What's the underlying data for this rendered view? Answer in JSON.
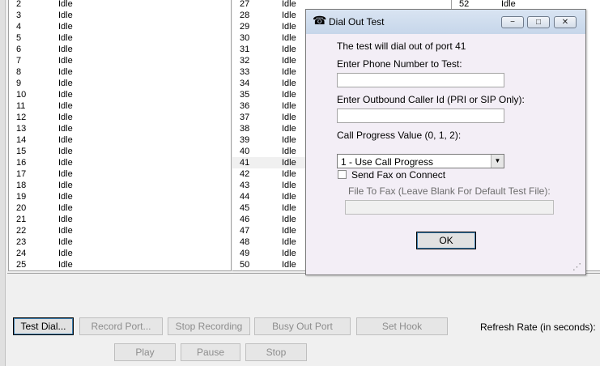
{
  "ports": {
    "column1": [
      {
        "port": "2",
        "status": "Idle"
      },
      {
        "port": "3",
        "status": "Idle"
      },
      {
        "port": "4",
        "status": "Idle"
      },
      {
        "port": "5",
        "status": "Idle"
      },
      {
        "port": "6",
        "status": "Idle"
      },
      {
        "port": "7",
        "status": "Idle"
      },
      {
        "port": "8",
        "status": "Idle"
      },
      {
        "port": "9",
        "status": "Idle"
      },
      {
        "port": "10",
        "status": "Idle"
      },
      {
        "port": "11",
        "status": "Idle"
      },
      {
        "port": "12",
        "status": "Idle"
      },
      {
        "port": "13",
        "status": "Idle"
      },
      {
        "port": "14",
        "status": "Idle"
      },
      {
        "port": "15",
        "status": "Idle"
      },
      {
        "port": "16",
        "status": "Idle"
      },
      {
        "port": "17",
        "status": "Idle"
      },
      {
        "port": "18",
        "status": "Idle"
      },
      {
        "port": "19",
        "status": "Idle"
      },
      {
        "port": "20",
        "status": "Idle"
      },
      {
        "port": "21",
        "status": "Idle"
      },
      {
        "port": "22",
        "status": "Idle"
      },
      {
        "port": "23",
        "status": "Idle"
      },
      {
        "port": "24",
        "status": "Idle"
      },
      {
        "port": "25",
        "status": "Idle"
      }
    ],
    "column2": [
      {
        "port": "27",
        "status": "Idle"
      },
      {
        "port": "28",
        "status": "Idle"
      },
      {
        "port": "29",
        "status": "Idle"
      },
      {
        "port": "30",
        "status": "Idle"
      },
      {
        "port": "31",
        "status": "Idle"
      },
      {
        "port": "32",
        "status": "Idle"
      },
      {
        "port": "33",
        "status": "Idle"
      },
      {
        "port": "34",
        "status": "Idle"
      },
      {
        "port": "35",
        "status": "Idle"
      },
      {
        "port": "36",
        "status": "Idle"
      },
      {
        "port": "37",
        "status": "Idle"
      },
      {
        "port": "38",
        "status": "Idle"
      },
      {
        "port": "39",
        "status": "Idle"
      },
      {
        "port": "40",
        "status": "Idle"
      },
      {
        "port": "41",
        "status": "Idle",
        "highlighted": true
      },
      {
        "port": "42",
        "status": "Idle"
      },
      {
        "port": "43",
        "status": "Idle"
      },
      {
        "port": "44",
        "status": "Idle"
      },
      {
        "port": "45",
        "status": "Idle"
      },
      {
        "port": "46",
        "status": "Idle"
      },
      {
        "port": "47",
        "status": "Idle"
      },
      {
        "port": "48",
        "status": "Idle"
      },
      {
        "port": "49",
        "status": "Idle"
      },
      {
        "port": "50",
        "status": "Idle"
      }
    ],
    "column3": [
      {
        "port": "52",
        "status": "Idle"
      }
    ]
  },
  "buttons": {
    "test_dial": "Test Dial...",
    "record_port": "Record Port...",
    "stop_recording": "Stop Recording",
    "busy_out_port": "Busy Out Port",
    "set_hook": "Set Hook",
    "play": "Play",
    "pause": "Pause",
    "stop": "Stop"
  },
  "refresh_rate_label": "Refresh Rate (in seconds):",
  "dialog": {
    "title": "Dial Out Test",
    "title_icon": "phone-icon",
    "intro": "The test will dial out of port 41",
    "phone_label": "Enter Phone Number to Test:",
    "phone_value": "",
    "caller_id_label": "Enter Outbound Caller Id (PRI or SIP Only):",
    "caller_id_value": "",
    "progress_label": "Call Progress Value (0, 1, 2):",
    "progress_selected": "1 - Use Call Progress",
    "send_fax_label": "Send Fax on Connect",
    "send_fax_checked": false,
    "fax_file_label": "File To Fax (Leave Blank For Default Test File):",
    "fax_file_value": "",
    "ok_label": "OK",
    "min_glyph": "−",
    "max_glyph": "□",
    "close_glyph": "✕",
    "dropdown_glyph": "▼",
    "grip_glyph": "⋰"
  },
  "colors": {
    "background": "#f0f0f0",
    "dialog_bg": "#f3eef6",
    "title_bar": "#c6d6ea",
    "default_button_accent": "#3c7fb1"
  }
}
